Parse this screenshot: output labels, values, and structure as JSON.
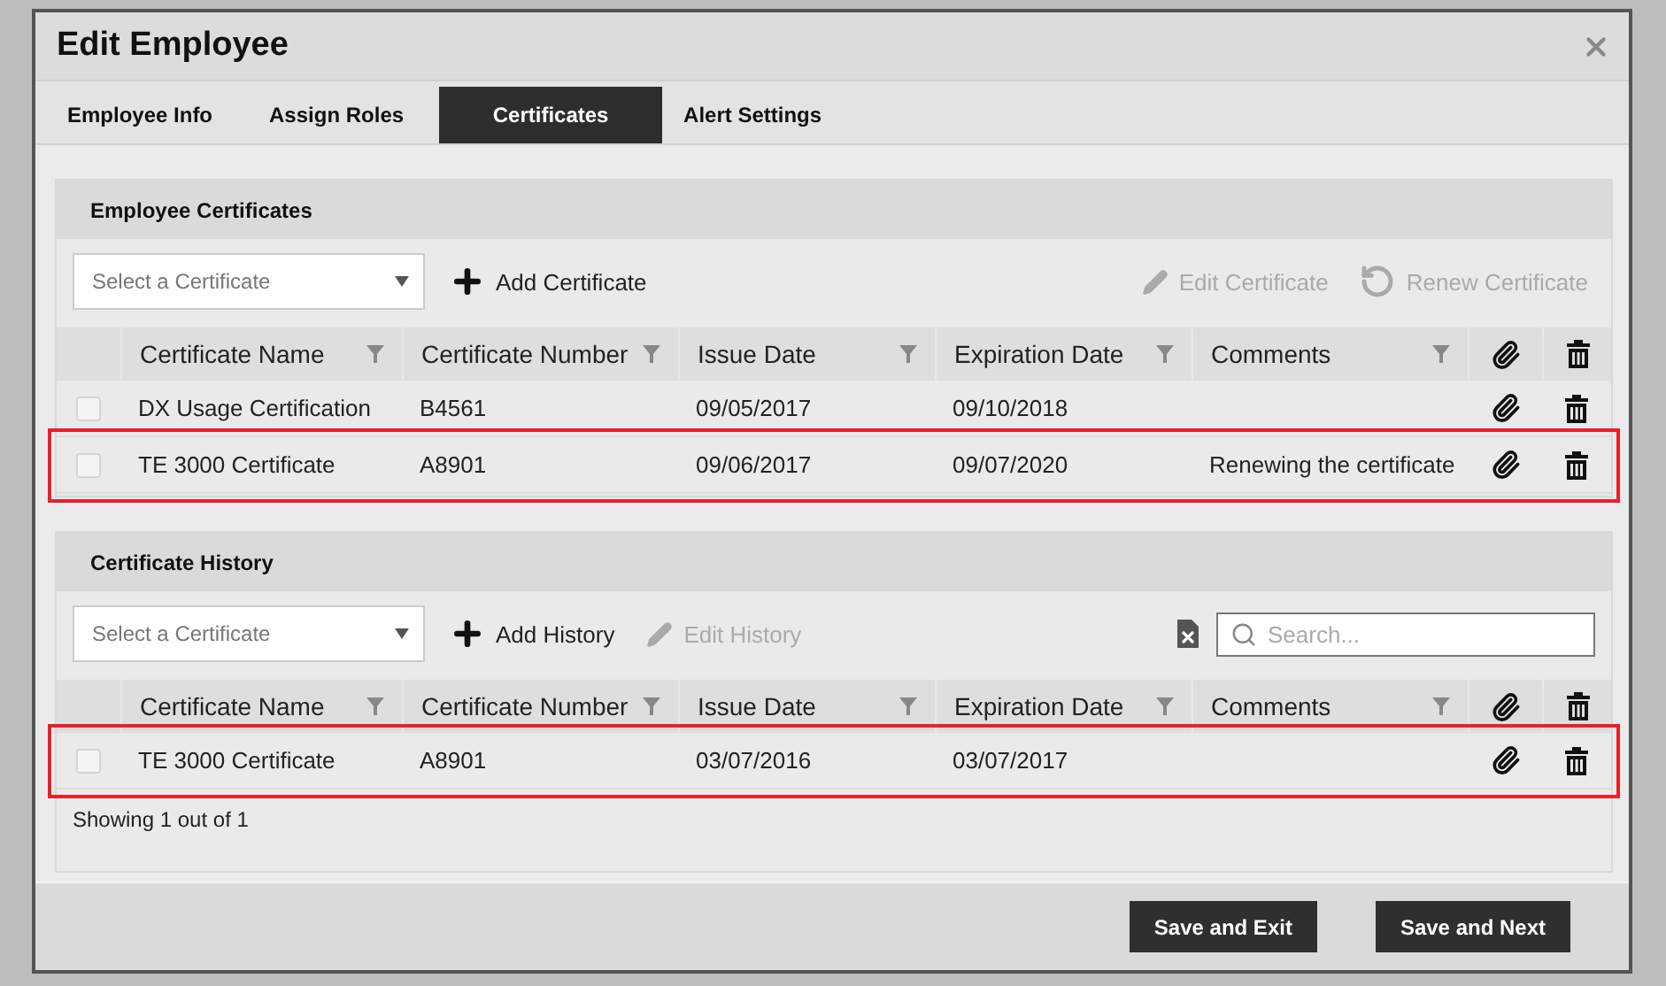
{
  "dialog": {
    "title": "Edit Employee"
  },
  "tabs": [
    {
      "label": "Employee Info",
      "selected": false
    },
    {
      "label": "Assign Roles",
      "selected": false
    },
    {
      "label": "Certificates",
      "selected": true
    },
    {
      "label": "Alert Settings",
      "selected": false
    }
  ],
  "sections": [
    {
      "title": "Employee Certificates",
      "select": {
        "placeholder": "Select a Certificate"
      },
      "actions": [
        {
          "kind": "add",
          "label": "Add Certificate",
          "disabled": false
        }
      ],
      "right_actions": [
        {
          "kind": "edit",
          "label": "Edit Certificate",
          "disabled": true
        },
        {
          "kind": "renew",
          "label": "Renew Certificate",
          "disabled": true
        }
      ],
      "columns": [
        {
          "label": "Certificate Name",
          "filter": true
        },
        {
          "label": "Certificate Number",
          "filter": true
        },
        {
          "label": "Issue Date",
          "filter": true
        },
        {
          "label": "Expiration Date",
          "filter": true
        },
        {
          "label": "Comments",
          "filter": true
        }
      ],
      "rows": [
        {
          "checked": false,
          "highlighted": false,
          "cells": [
            "DX Usage Certification",
            "B4561",
            "09/05/2017",
            "09/10/2018",
            ""
          ]
        },
        {
          "checked": false,
          "highlighted": true,
          "cells": [
            "TE 3000 Certificate",
            "A8901",
            "09/06/2017",
            "09/07/2020",
            "Renewing the certificate"
          ]
        }
      ]
    },
    {
      "title": "Certificate History",
      "select": {
        "placeholder": "Select a Certificate"
      },
      "actions": [
        {
          "kind": "add",
          "label": "Add History",
          "disabled": false
        },
        {
          "kind": "edit",
          "label": "Edit History",
          "disabled": true
        }
      ],
      "export": true,
      "search": {
        "placeholder": "Search..."
      },
      "columns": [
        {
          "label": "Certificate Name",
          "filter": true
        },
        {
          "label": "Certificate Number",
          "filter": true
        },
        {
          "label": "Issue Date",
          "filter": true
        },
        {
          "label": "Expiration Date",
          "filter": true
        },
        {
          "label": "Comments",
          "filter": true
        }
      ],
      "rows": [
        {
          "checked": false,
          "highlighted": true,
          "cells": [
            "TE 3000 Certificate",
            "A8901",
            "03/07/2016",
            "03/07/2017",
            ""
          ]
        }
      ],
      "footer": "Showing 1 out of 1"
    }
  ],
  "buttons": [
    "Save and Exit",
    "Save and Next"
  ]
}
